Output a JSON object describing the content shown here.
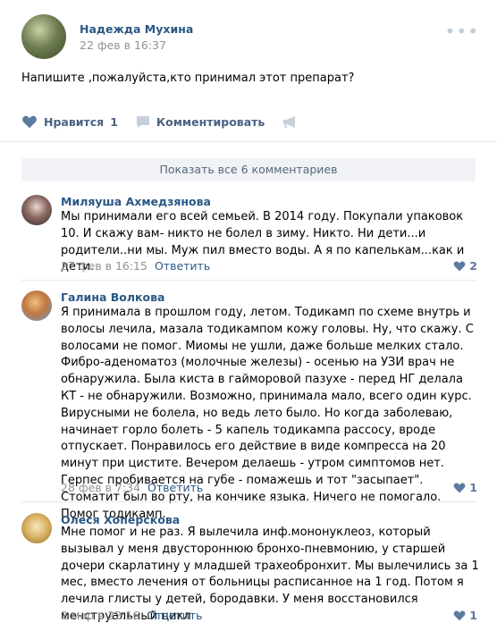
{
  "post": {
    "author": "Надежда Мухина",
    "date": "22 фев в 16:37",
    "text": "Напишите ,пожалуйста,кто принимал этот препарат?",
    "like_label": "Нравится",
    "like_count": "1",
    "comment_label": "Комментировать"
  },
  "show_all_label": "Показать все 6 комментариев",
  "comments": [
    {
      "author": "Миляуша Ахмедзянова",
      "text": "Мы принимали его всей семьей. В 2014 году. Покупали упаковок 10. И скажу вам- никто не болел в зиму. Никто. Ни дети...и родители..ни мы. Муж пил вместо воды. А я по капелькам...как и дети.",
      "date": "27 фев в 16:15",
      "reply": "Ответить",
      "likes": "2"
    },
    {
      "author": "Галина Волкова",
      "text": "Я принимала в прошлом году, летом. Тодикамп по схеме внутрь и волосы лечила, мазала тодикампом кожу головы. Ну, что скажу. С волосами не помог. Миомы не ушли, даже больше мелких стало. Фибро-аденоматоз (молочные железы) - осенью на УЗИ врач не обнаружила. Была киста в гайморовой пазухе - перед НГ делала КТ - не обнаружили. Возможно, принимала мало, всего один курс. Вирусными не болела, но ведь лето было. Но когда заболеваю, начинает горло болеть - 5 капель тодикампа рассосу, вроде отпускает. Понравилось его действие в виде компресса на 20 минут при цистите. Вечером делаешь - утром симптомов нет. Герпес пробивается на губе - помажешь и тот \"засыпает\". Стоматит был во рту, на кончике языка. Ничего не помогало. Помог тодикамп.",
      "date": "28 фев в 7:34",
      "reply": "Ответить",
      "likes": "1"
    },
    {
      "author": "Олеся Хоперскова",
      "text": "Мне помог и не раз. Я вылечила инф.мононуклеоз, который вызывал у меня двустороннюю бронхо-пневмонию, у старшей дочери скарлатину у младшей трахеобронхит. Мы вылечились за 1 мес, вместо лечения от больницы расписанное на 1 год. Потом я лечила глисты у детей, бородавки. У меня восстановился менструальный цикл",
      "date": "2 мар в 22:16",
      "reply": "Ответить",
      "likes": "1"
    }
  ],
  "colors": {
    "link": "#2a5885",
    "meta": "#939393",
    "icon": "#5b7ba0",
    "divider": "#e7e8ec",
    "show_all_bg": "#f0f2f5"
  }
}
